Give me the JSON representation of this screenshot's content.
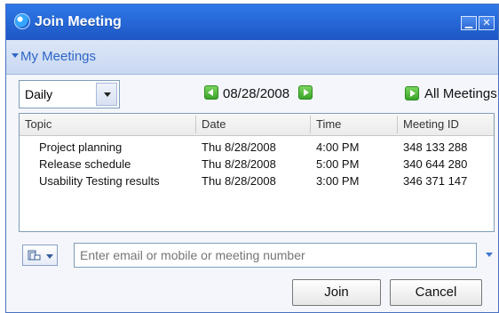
{
  "window": {
    "title": "Join Meeting"
  },
  "section": {
    "label": "My Meetings"
  },
  "filter": {
    "selected": "Daily"
  },
  "date_nav": {
    "date": "08/28/2008"
  },
  "all_meetings": {
    "label": "All Meetings"
  },
  "table": {
    "columns": [
      "Topic",
      "Date",
      "Time",
      "Meeting ID"
    ],
    "rows": [
      [
        "Project planning",
        "Thu 8/28/2008",
        "4:00 PM",
        "348 133 288"
      ],
      [
        "Release schedule",
        "Thu 8/28/2008",
        "5:00 PM",
        "340 644 280"
      ],
      [
        "Usability Testing results",
        "Thu 8/28/2008",
        "3:00 PM",
        "346 371 147"
      ]
    ]
  },
  "input": {
    "placeholder": "Enter email or mobile or meeting number"
  },
  "buttons": {
    "join": "Join",
    "cancel": "Cancel"
  },
  "icons": {
    "app": "globe-icon",
    "minimize": "minimize-icon",
    "close": "close-icon",
    "collapse": "collapse-triangle-icon",
    "prev": "left-arrow-icon",
    "next": "right-arrow-icon",
    "all_meetings": "right-arrow-icon",
    "phone": "phone-book-icon"
  },
  "colors": {
    "titlebar": "#1d57c4",
    "link": "#2d66c8",
    "accent_green": "#3aa329"
  }
}
